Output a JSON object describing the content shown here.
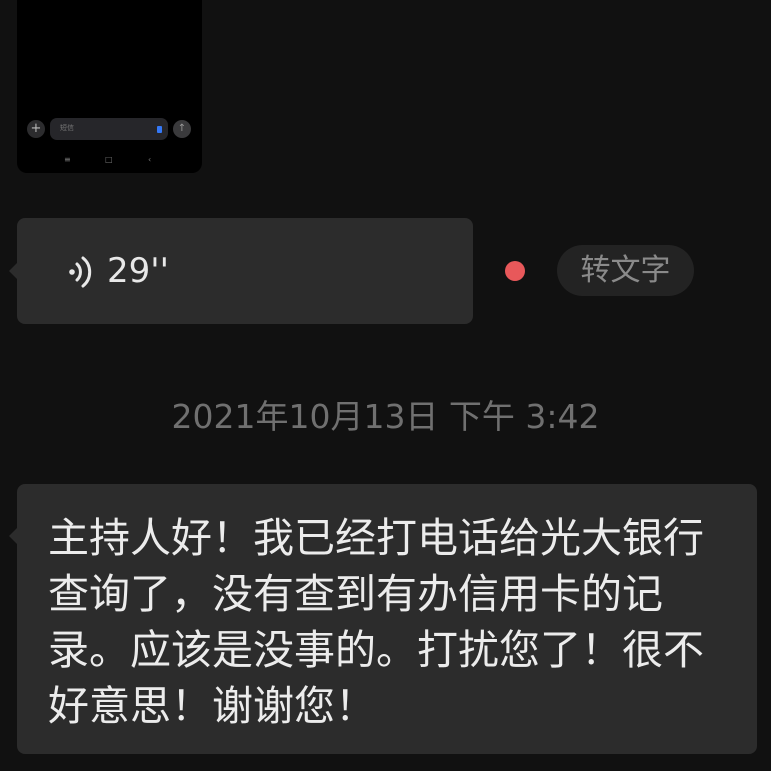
{
  "image_message": {
    "input_placeholder": "短信",
    "plus_icon": "plus-icon",
    "send_icon": "arrow-up-icon",
    "nav_icons": [
      "menu-icon",
      "home-icon",
      "back-icon"
    ]
  },
  "voice_message": {
    "icon": "voice-waves-icon",
    "duration": "29''",
    "unread_color": "#e8585a",
    "transcribe_label": "转文字"
  },
  "timestamp": "2021年10月13日 下午 3:42",
  "text_message": {
    "body": "主持人好！我已经打电话给光大银行查询了，没有查到有办信用卡的记录。应该是没事的。打扰您了！很不好意思！谢谢您！"
  }
}
